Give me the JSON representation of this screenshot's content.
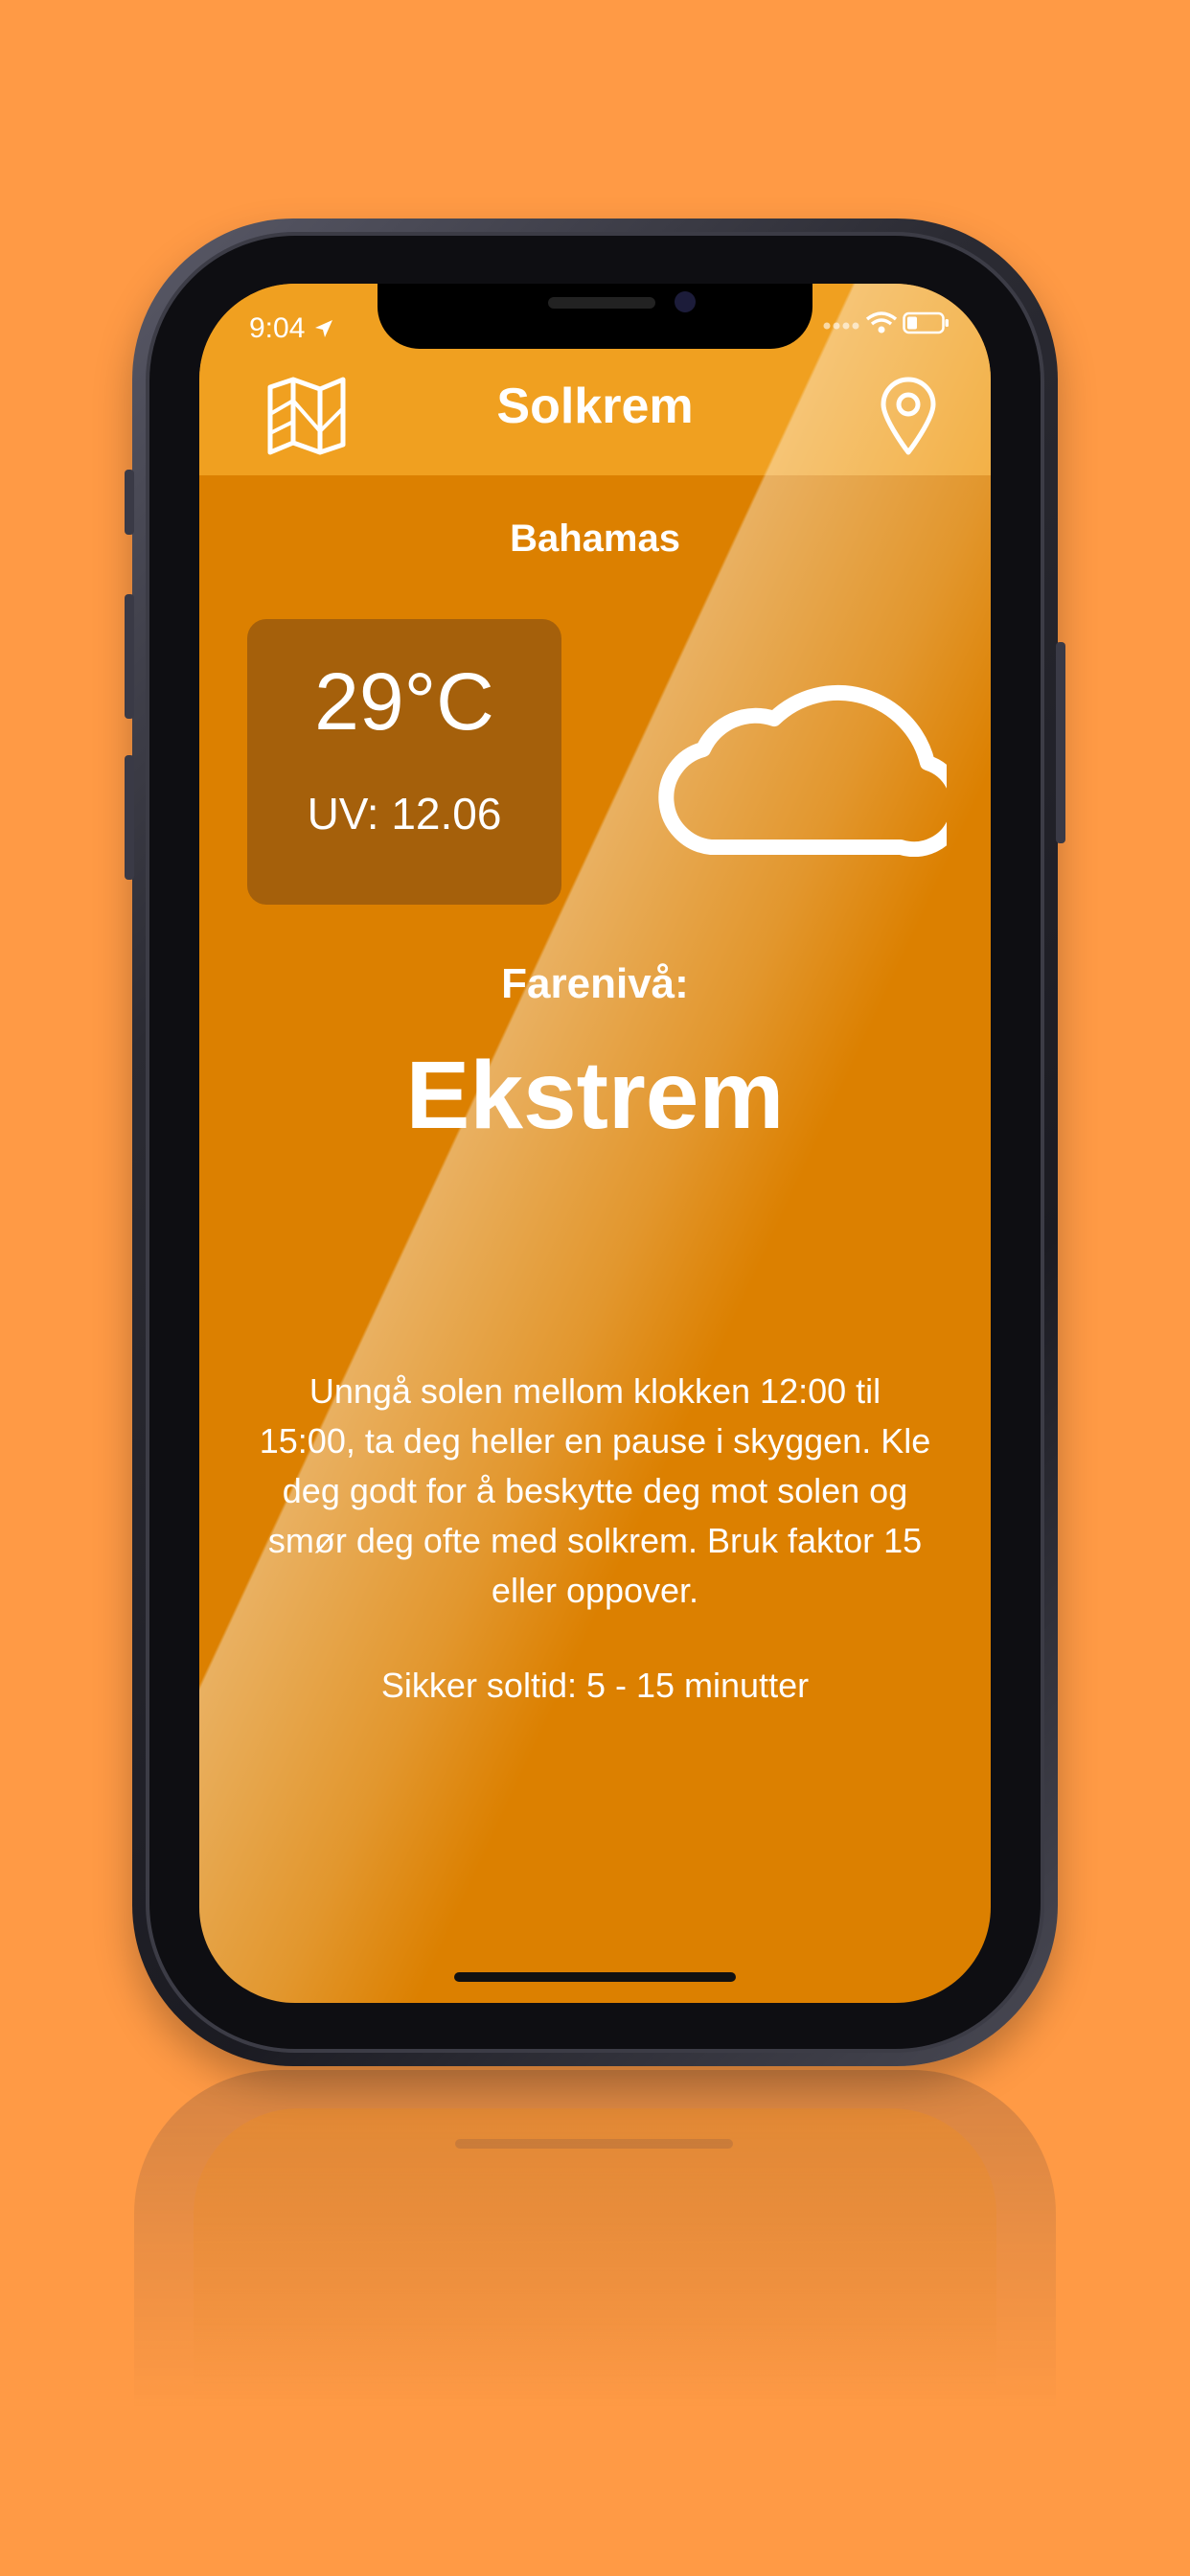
{
  "status_bar": {
    "time": "9:04"
  },
  "header": {
    "title": "Solkrem",
    "map_icon": "map-icon",
    "location_icon": "location-pin-icon"
  },
  "main": {
    "location": "Bahamas",
    "temperature": "29°C",
    "uv": "UV: 12.06",
    "weather_icon": "cloud-icon",
    "danger_label": "Farenivå:",
    "danger_value": "Ekstrem",
    "advice": "Unngå solen mellom klokken 12:00 til 15:00, ta deg heller en pause i skyggen. Kle deg godt for å beskytte deg mot solen og smør deg ofte med solkrem. Bruk faktor 15 eller oppover.",
    "safe_time": "Sikker soltid: 5 - 15 minutter"
  },
  "colors": {
    "background": "#ff9a45",
    "screen": "#dc8000",
    "navbar": "#f0a020",
    "card": "#8a5418"
  }
}
